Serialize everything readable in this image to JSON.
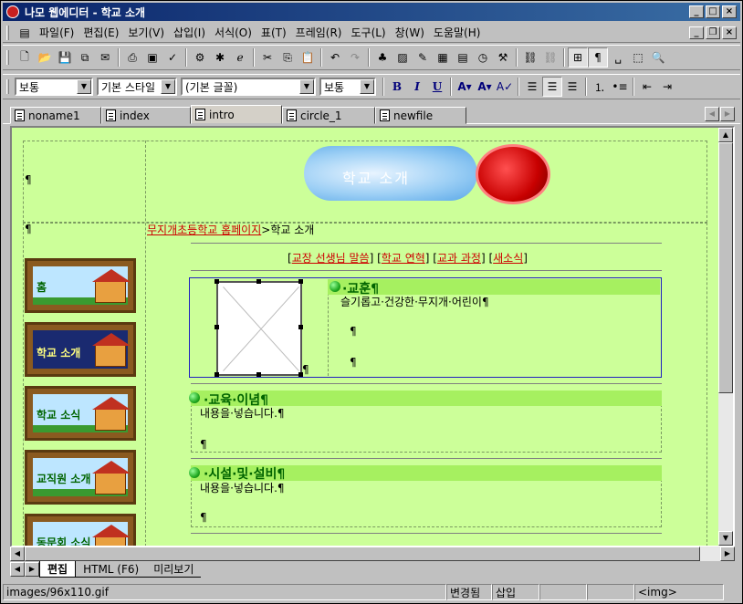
{
  "window": {
    "title": "나모 웹에디터 - 학교 소개"
  },
  "menu": {
    "items": [
      "파일(F)",
      "편집(E)",
      "보기(V)",
      "삽입(I)",
      "서식(O)",
      "표(T)",
      "프레임(R)",
      "도구(L)",
      "창(W)",
      "도움말(H)"
    ]
  },
  "format_toolbar": {
    "paragraph_style": "보통",
    "char_style": "기본 스타일",
    "font": "(기본 글꼴)",
    "size": "보통",
    "bold": "B",
    "italic": "I",
    "underline": "U"
  },
  "doc_tabs": [
    "noname1",
    "index",
    "intro",
    "circle_1",
    "newfile"
  ],
  "page": {
    "banner_text": "학교 소개",
    "breadcrumb_link": "무지개초등학교 홈페이지",
    "breadcrumb_rest": ">학교 소개",
    "submenu": [
      {
        "label": "교장 선생님 말씀"
      },
      {
        "label": "학교 연혁"
      },
      {
        "label": "교과 과정"
      },
      {
        "label": "새소식"
      }
    ],
    "nav_buttons": [
      "홈",
      "학교 소개",
      "학교 소식",
      "교직원 소개",
      "동문회 소식"
    ],
    "motto_title": "·교훈¶",
    "motto_text": "슬기롭고·건강한·무지개·어린이¶",
    "edu_title": "·교육·이념¶",
    "edu_text": "내용을·넣습니다.¶",
    "facility_title": "·시설·및·설비¶",
    "facility_text": "내용을·넣습니다.¶",
    "pilcrow": "¶"
  },
  "view_tabs": [
    "편집",
    "HTML (F6)",
    "미리보기"
  ],
  "status": {
    "path": "images/96x110.gif",
    "modified": "변경됨",
    "mode": "삽입",
    "tag": "<img>"
  },
  "colors": {
    "editor_bg": "#ccff99",
    "section_bar": "#a6f060",
    "link_red": "#cc0000"
  }
}
